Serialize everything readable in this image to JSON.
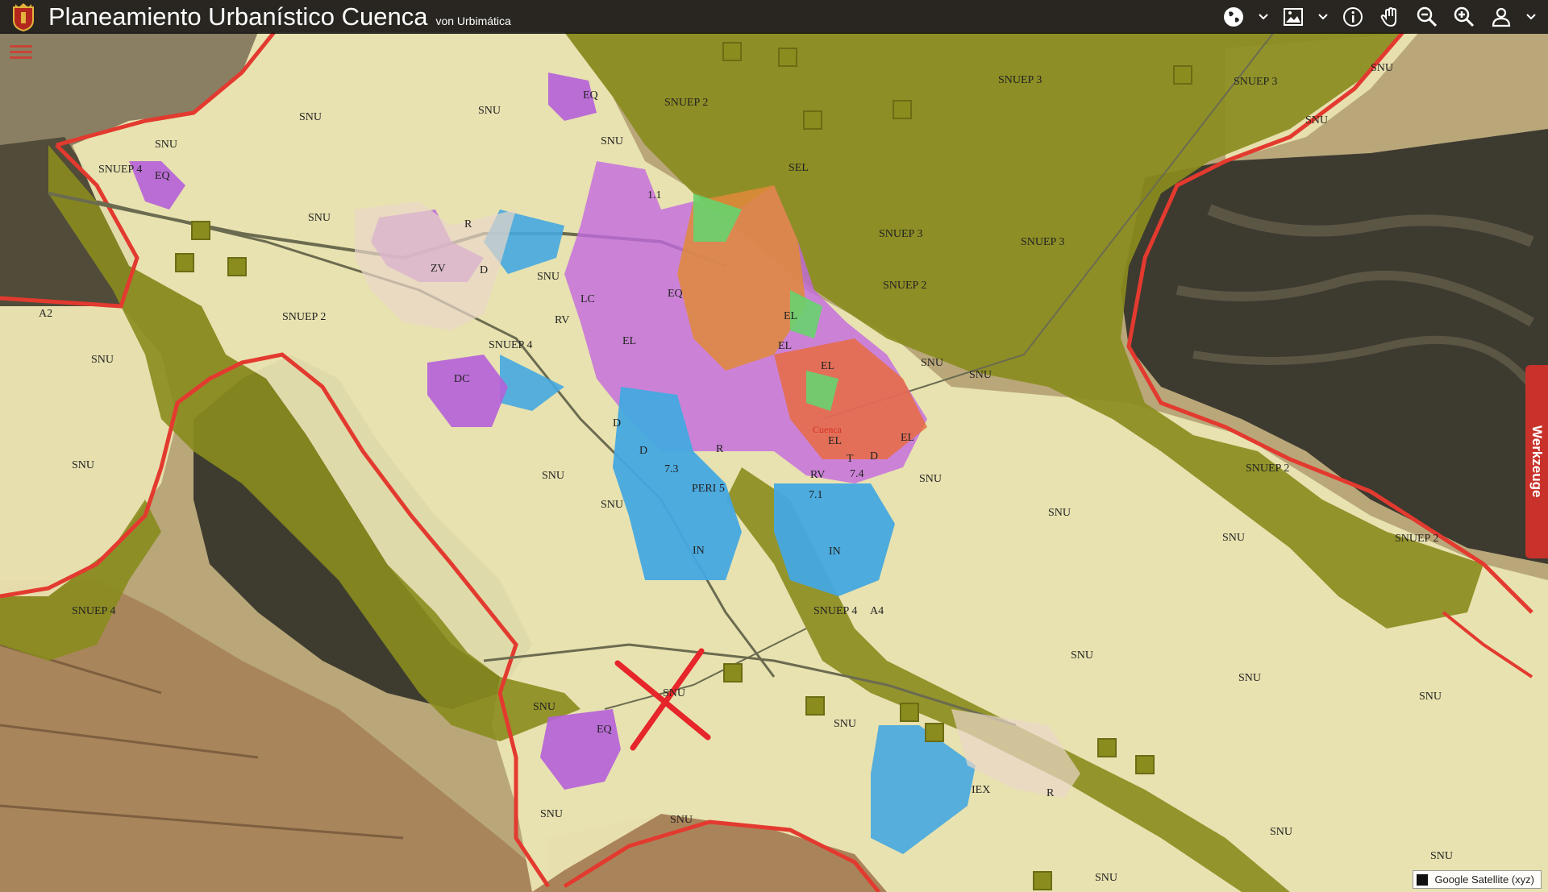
{
  "header": {
    "title": "Planeamiento Urbanístico Cuenca",
    "subtitle": "von Urbimática"
  },
  "toolbar": {
    "tools": [
      "globe-icon",
      "image-layers-icon",
      "info-icon",
      "pan-hand-icon",
      "zoom-out-icon",
      "zoom-in-icon",
      "user-icon"
    ]
  },
  "side_tab": {
    "label": "Werkzeuge"
  },
  "attribution": {
    "label": "Google Satellite (xyz)"
  },
  "map": {
    "labels": {
      "snu_1": "SNU",
      "snu_2": "SNU",
      "snu_3": "SNU",
      "snu_4": "SNU",
      "snu_5": "SNU",
      "snu_6": "SNU",
      "snu_7": "SNU",
      "snu_8": "SNU",
      "snu_9": "SNU",
      "snu_10": "SNU",
      "snu_11": "SNU",
      "snu_12": "SNU",
      "snu_13": "SNU",
      "snu_14": "SNU",
      "snu_15": "SNU",
      "snu_16": "SNU",
      "snu_17": "SNU",
      "snu_18": "SNU",
      "snu_19": "SNU",
      "snu_20": "SNU",
      "snu_21": "SNU",
      "snu_22": "SNU",
      "snu_23": "SNU",
      "snu_24": "SNU",
      "snu_25": "SNU",
      "snu_26": "SNU",
      "snu_27": "SNU",
      "snu_28": "SNU",
      "snuep4_a": "SNUEP 4",
      "snuep4_b": "SNUEP 4",
      "snuep4_c": "SNUEP 4",
      "snuep4_d": "SNUEP 4",
      "snuep2_a": "SNUEP 2",
      "snuep2_b": "SNUEP 2",
      "snuep2_c": "SNUEP 2",
      "snuep2_d": "SNUEP 2",
      "snuep2_e": "SNUEP 2",
      "snuep3_a": "SNUEP 3",
      "snuep3_b": "SNUEP 3",
      "snuep3_c": "SNUEP 3",
      "snuep3_d": "SNUEP 3",
      "eq_1": "EQ",
      "eq_2": "EQ",
      "eq_3": "EQ",
      "eq_4": "EQ",
      "r_1": "R",
      "r_2": "R",
      "r_3": "R",
      "zv": "ZV",
      "d_1": "D",
      "d_2": "D",
      "d_3": "D",
      "d_4": "D",
      "lc": "LC",
      "rv_1": "RV",
      "rv_2": "RV",
      "el_1": "EL",
      "el_2": "EL",
      "el_3": "EL",
      "el_4": "EL",
      "el_5": "EL",
      "el_6": "EL",
      "dc": "DC",
      "in_1": "IN",
      "in_2": "IN",
      "peri5": "PERI 5",
      "n73": "7.3",
      "n71": "7.1",
      "n74": "7.4",
      "n11": "1.1",
      "sel": "SEL",
      "a2": "A2",
      "a4": "A4",
      "iex": "IEX",
      "t": "T",
      "cuenca": "Cuenca"
    }
  }
}
